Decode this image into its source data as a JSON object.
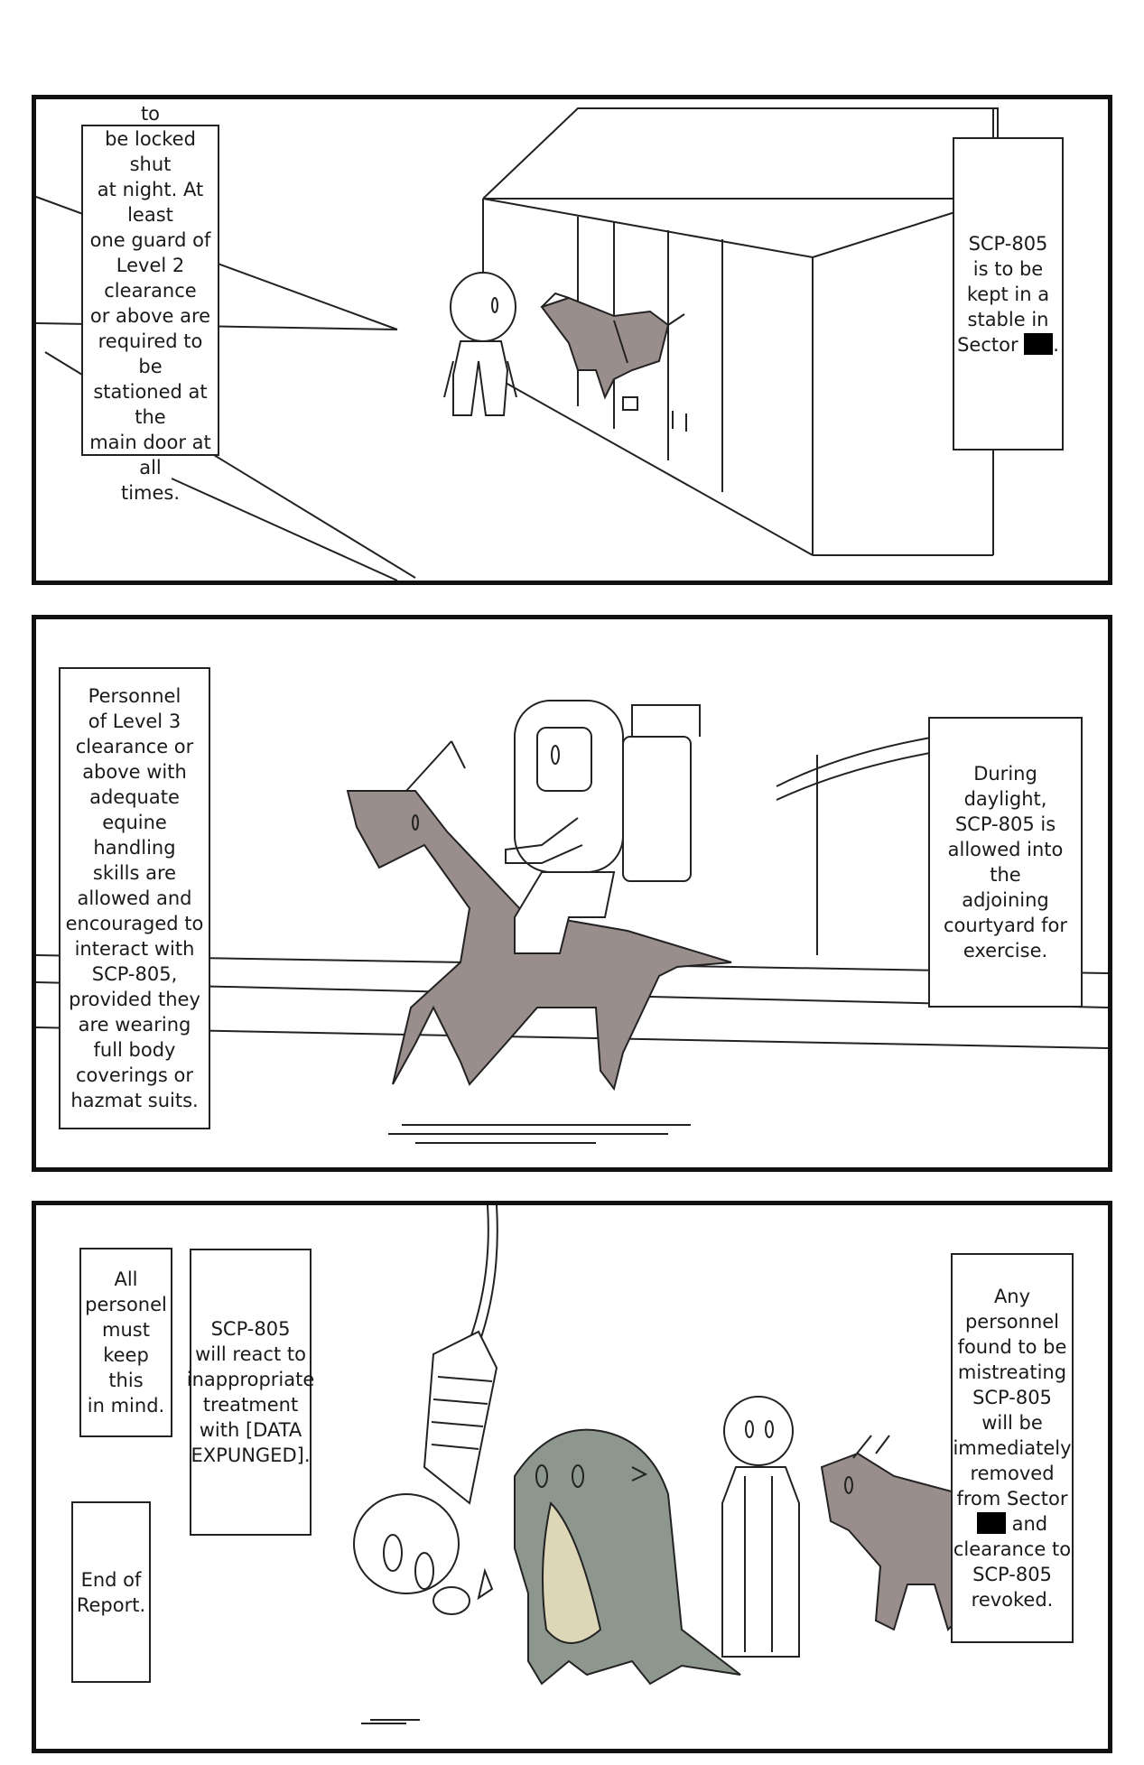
{
  "panels": [
    {
      "captions": {
        "stable_note": "The stable is to\nbe locked shut\nat night. At least\none guard of\nLevel 2 clearance\nor above are\nrequired to be\nstationed at the\nmain door at all\ntimes.",
        "containment_prefix": "SCP-805\nis to be\nkept in a\nstable in\nSector ",
        "containment_suffix": "."
      }
    },
    {
      "captions": {
        "personnel_note": "Personnel\nof Level 3\nclearance or\nabove with\nadequate\nequine handling\nskills are\nallowed and\nencouraged to\ninteract with\nSCP-805,\nprovided they\nare wearing\nfull body\ncoverings or\nhazmat suits.",
        "daylight_note": "During daylight,\nSCP-805 is\nallowed into the\nadjoining\ncourtyard for\nexercise."
      }
    },
    {
      "captions": {
        "mind_note": "All\npersonel\nmust\nkeep this\nin mind.",
        "react_note": "SCP-805\nwill react to\ninappropriate\ntreatment\nwith [DATA\nEXPUNGED].",
        "end_note": "End of\nReport.",
        "mistreat_prefix": "Any\npersonnel\nfound to be\nmistreating\nSCP-805\nwill be\nimmediately\nremoved\nfrom Sector\n",
        "mistreat_suffix": " and\nclearance to\nSCP-805\nrevoked."
      }
    }
  ]
}
